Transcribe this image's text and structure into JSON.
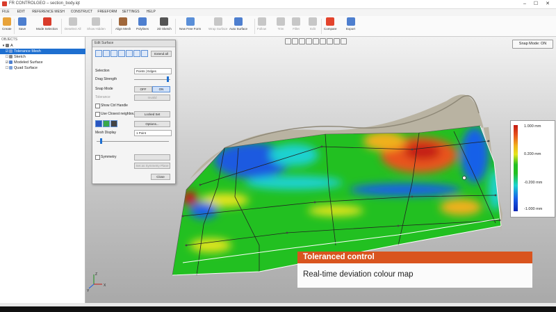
{
  "window": {
    "title": "FR CONTROLGEO – section_body.iqt"
  },
  "menu": [
    "FILE",
    "EDIT",
    "REFERENCE MESH",
    "CONSTRUCT",
    "FREEFORM",
    "SETTINGS",
    "HELP"
  ],
  "toolbar": [
    {
      "label": "Create",
      "icon": "folder-icon",
      "color": "#e8a33a",
      "dim": false
    },
    {
      "label": "Save",
      "icon": "save-icon",
      "color": "#4e7fcf",
      "dim": false
    },
    {
      "label": "Mode Selection",
      "icon": "mode-icon",
      "color": "#d93c2b",
      "dim": false
    },
    {
      "label": "Deselect All",
      "icon": "deselect-icon",
      "color": "#c7c7c7",
      "dim": true
    },
    {
      "label": "Show Hidden",
      "icon": "eye-icon",
      "color": "#c7c7c7",
      "dim": true
    },
    {
      "label": "Align Mesh",
      "icon": "align-icon",
      "color": "#a0673a",
      "dim": false
    },
    {
      "label": "Polylines",
      "icon": "polyline-icon",
      "color": "#4e7fcf",
      "dim": false
    },
    {
      "label": "2D Sketch",
      "icon": "sketch-icon",
      "color": "#555555",
      "dim": false
    },
    {
      "label": "New Free Form",
      "icon": "freeform-icon",
      "color": "#5a8fd8",
      "dim": false
    },
    {
      "label": "Wrap Surface",
      "icon": "wrap-icon",
      "color": "#c7c7c7",
      "dim": true
    },
    {
      "label": "Auto Surface",
      "icon": "auto-surface-icon",
      "color": "#4e7fcf",
      "dim": false
    },
    {
      "label": "Follow",
      "icon": "follow-icon",
      "color": "#c7c7c7",
      "dim": true
    },
    {
      "label": "Trim",
      "icon": "trim-icon",
      "color": "#c7c7c7",
      "dim": true
    },
    {
      "label": "Fillet",
      "icon": "fillet-icon",
      "color": "#c7c7c7",
      "dim": true
    },
    {
      "label": "Edit",
      "icon": "edit-icon",
      "color": "#c7c7c7",
      "dim": true
    },
    {
      "label": "Compare",
      "icon": "compare-icon",
      "color": "#e3442d",
      "dim": false
    },
    {
      "label": "Export",
      "icon": "export-icon",
      "color": "#4e7fcf",
      "dim": false
    }
  ],
  "tree": {
    "header": "OBJECTS",
    "items": [
      {
        "label": "A",
        "toggle": "▾",
        "icon": "#777777",
        "selected": false,
        "indent": 0
      },
      {
        "label": "Tolerance Mesh",
        "toggle": "☑",
        "icon": "#7aa0d8",
        "selected": true,
        "indent": 1
      },
      {
        "label": "Sketch",
        "toggle": "☐",
        "icon": "#888888",
        "selected": false,
        "indent": 1
      },
      {
        "label": "Modeled Surface",
        "toggle": "☑",
        "icon": "#4e7fcf",
        "selected": false,
        "indent": 1
      },
      {
        "label": "Quad Surface",
        "toggle": "☐",
        "icon": "#7aa0d8",
        "selected": false,
        "indent": 1
      }
    ]
  },
  "panel": {
    "title": "Edit Surface",
    "extend_all": "Extend all",
    "selection_label": "Selection",
    "selection_value": "Points | Edges",
    "drag_strength_label": "Drag Strength",
    "drag_strength": 0.95,
    "snap_mode_label": "Snap Mode",
    "snap_off": "OFF",
    "snap_on": "ON",
    "tolerance_label": "Tolerance",
    "tolerance_value": "Invalid",
    "show_ctrl_label": "Show Ctrl Handle",
    "use_closest_label": "Use Closest neighbours",
    "locked_set": "Locked Set",
    "options_button": "Options...",
    "mesh_display_label": "Mesh Display",
    "mesh_display_value": "1 Point",
    "mesh_slider": 0.05,
    "symmetry_label": "Symmetry",
    "set_symmetry": "Set as Symmetry Plane",
    "close_button": "Close"
  },
  "viewport": {
    "snap_mode": "Snap Mode: ON",
    "legend": {
      "unit": "mm",
      "labels": [
        "1.000 mm",
        "0.200 mm",
        "-0.200 mm",
        "-1.000 mm"
      ],
      "colors": [
        "#c41a12",
        "#e8541c",
        "#f0b11c",
        "#e4e51a",
        "#22c021",
        "#1ad2d0",
        "#1860e8",
        "#0a25b5"
      ]
    },
    "axes": {
      "z": "Z",
      "x": "X",
      "y": "Y"
    }
  },
  "caption": {
    "title": "Toleranced control",
    "subtitle": "Real-time deviation colour map",
    "accent": "#d9541e"
  }
}
